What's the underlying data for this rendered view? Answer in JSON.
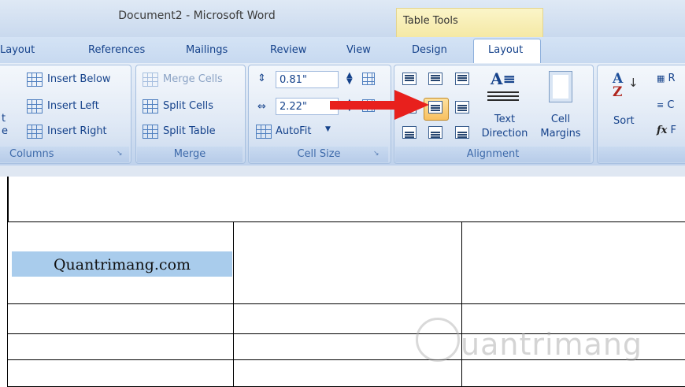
{
  "window": {
    "title": "Document2 - Microsoft Word",
    "contextual_label": "Table Tools"
  },
  "tabs": [
    {
      "label": "Layout"
    },
    {
      "label": "References"
    },
    {
      "label": "Mailings"
    },
    {
      "label": "Review"
    },
    {
      "label": "View"
    },
    {
      "label": "Design"
    },
    {
      "label": "Layout"
    }
  ],
  "ribbon": {
    "rows_columns": {
      "label": "Columns",
      "insert_below": "Insert Below",
      "insert_left": "Insert Left",
      "insert_right": "Insert Right",
      "cut_t": "t",
      "cut_e": "e"
    },
    "merge": {
      "label": "Merge",
      "merge_cells": "Merge Cells",
      "split_cells": "Split Cells",
      "split_table": "Split Table"
    },
    "cell_size": {
      "label": "Cell Size",
      "height": "0.81\"",
      "width": "2.22\"",
      "autofit": "AutoFit"
    },
    "alignment": {
      "label": "Alignment",
      "text_direction_1": "Text",
      "text_direction_2": "Direction",
      "cell_margins_1": "Cell",
      "cell_margins_2": "Margins",
      "selected": "align-center-left"
    },
    "data": {
      "sort": "Sort",
      "r_cut": "R",
      "c_cut": "C",
      "f_cut": "F"
    }
  },
  "document": {
    "cell_text": "Quantrimang.com",
    "watermark": "uantrimang"
  },
  "colors": {
    "arrow": "#e8201d",
    "highlight": "#a9ccec",
    "accent": "#15428b"
  }
}
